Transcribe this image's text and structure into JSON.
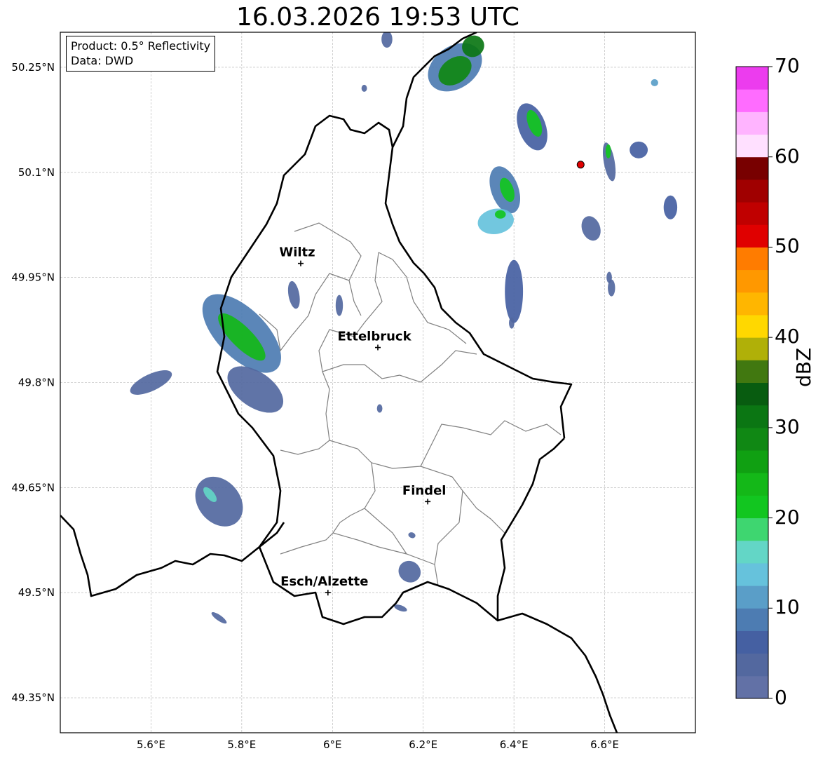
{
  "title": "16.03.2026 19:53 UTC",
  "info": {
    "product": "Product: 0.5° Reflectivity",
    "source": "Data: DWD"
  },
  "axes": {
    "lon_ticks": [
      {
        "value": 5.6,
        "label": "5.6°E"
      },
      {
        "value": 5.8,
        "label": "5.8°E"
      },
      {
        "value": 6.0,
        "label": "6°E"
      },
      {
        "value": 6.2,
        "label": "6.2°E"
      },
      {
        "value": 6.4,
        "label": "6.4°E"
      },
      {
        "value": 6.6,
        "label": "6.6°E"
      }
    ],
    "lat_ticks": [
      {
        "value": 50.25,
        "label": "50.25°N"
      },
      {
        "value": 50.1,
        "label": "50.1°N"
      },
      {
        "value": 49.95,
        "label": "49.95°N"
      },
      {
        "value": 49.8,
        "label": "49.8°N"
      },
      {
        "value": 49.65,
        "label": "49.65°N"
      },
      {
        "value": 49.5,
        "label": "49.5°N"
      },
      {
        "value": 49.35,
        "label": "49.35°N"
      }
    ],
    "lon_range": [
      5.4,
      6.8
    ],
    "lat_range": [
      49.3,
      50.3
    ],
    "grid": true
  },
  "places": [
    {
      "name": "Wiltz",
      "lon": 5.93,
      "lat": 49.97
    },
    {
      "name": "Ettelbruck",
      "lon": 6.1,
      "lat": 49.85
    },
    {
      "name": "Findel",
      "lon": 6.21,
      "lat": 49.63
    },
    {
      "name": "Esch/Alzette",
      "lon": 5.99,
      "lat": 49.5
    }
  ],
  "radar_site": {
    "lon": 6.547,
    "lat": 50.111,
    "color": "#e00000"
  },
  "colorbar": {
    "unit": "dBZ",
    "min": 0,
    "max": 70,
    "step": 2.5,
    "ticks": [
      {
        "value": 0,
        "label": "0"
      },
      {
        "value": 10,
        "label": "10"
      },
      {
        "value": 20,
        "label": "20"
      },
      {
        "value": 30,
        "label": "30"
      },
      {
        "value": 40,
        "label": "40"
      },
      {
        "value": 50,
        "label": "50"
      },
      {
        "value": 60,
        "label": "60"
      },
      {
        "value": 70,
        "label": "70"
      }
    ],
    "colors": [
      "#6271a6",
      "#53689f",
      "#4560a2",
      "#4d7cb2",
      "#5a9ec8",
      "#66c2dc",
      "#63d6c6",
      "#3ed670",
      "#12c620",
      "#14b818",
      "#10a012",
      "#108814",
      "#0b7613",
      "#085c10",
      "#417810",
      "#b0b008",
      "#ffd800",
      "#ffb600",
      "#ff9800",
      "#ff7c00",
      "#e00000",
      "#c00000",
      "#a00000",
      "#780000",
      "#ffe0ff",
      "#ffb4ff",
      "#ff6cff",
      "#ec3cee"
    ]
  },
  "echoes": [
    {
      "lon": 6.27,
      "lat": 50.25,
      "rx": 0.065,
      "ry": 0.03,
      "rot": -35,
      "dbz": 8
    },
    {
      "lon": 6.27,
      "lat": 50.245,
      "rx": 0.04,
      "ry": 0.018,
      "rot": -35,
      "dbz": 28
    },
    {
      "lon": 6.31,
      "lat": 50.28,
      "rx": 0.025,
      "ry": 0.015,
      "rot": -35,
      "dbz": 30
    },
    {
      "lon": 6.12,
      "lat": 50.29,
      "rx": 0.012,
      "ry": 0.012,
      "rot": 0,
      "dbz": 4
    },
    {
      "lon": 6.44,
      "lat": 50.165,
      "rx": 0.03,
      "ry": 0.035,
      "rot": -20,
      "dbz": 6
    },
    {
      "lon": 6.445,
      "lat": 50.17,
      "rx": 0.014,
      "ry": 0.02,
      "rot": -20,
      "dbz": 22
    },
    {
      "lon": 6.61,
      "lat": 50.115,
      "rx": 0.012,
      "ry": 0.028,
      "rot": -10,
      "dbz": 4
    },
    {
      "lon": 6.608,
      "lat": 50.13,
      "rx": 0.006,
      "ry": 0.01,
      "rot": 0,
      "dbz": 20
    },
    {
      "lon": 6.675,
      "lat": 50.132,
      "rx": 0.02,
      "ry": 0.012,
      "rot": 0,
      "dbz": 6
    },
    {
      "lon": 6.71,
      "lat": 50.228,
      "rx": 0.008,
      "ry": 0.005,
      "rot": 0,
      "dbz": 12
    },
    {
      "lon": 6.38,
      "lat": 50.075,
      "rx": 0.03,
      "ry": 0.035,
      "rot": -20,
      "dbz": 8
    },
    {
      "lon": 6.385,
      "lat": 50.075,
      "rx": 0.014,
      "ry": 0.018,
      "rot": -20,
      "dbz": 22
    },
    {
      "lon": 6.36,
      "lat": 50.03,
      "rx": 0.04,
      "ry": 0.018,
      "rot": -10,
      "dbz": 14
    },
    {
      "lon": 6.37,
      "lat": 50.04,
      "rx": 0.012,
      "ry": 0.006,
      "rot": 0,
      "dbz": 22
    },
    {
      "lon": 6.745,
      "lat": 50.05,
      "rx": 0.015,
      "ry": 0.017,
      "rot": 0,
      "dbz": 5
    },
    {
      "lon": 6.57,
      "lat": 50.02,
      "rx": 0.02,
      "ry": 0.018,
      "rot": -20,
      "dbz": 4
    },
    {
      "lon": 6.615,
      "lat": 49.935,
      "rx": 0.008,
      "ry": 0.012,
      "rot": 0,
      "dbz": 4
    },
    {
      "lon": 6.4,
      "lat": 49.93,
      "rx": 0.02,
      "ry": 0.045,
      "rot": 0,
      "dbz": 5
    },
    {
      "lon": 6.395,
      "lat": 49.885,
      "rx": 0.006,
      "ry": 0.008,
      "rot": 0,
      "dbz": 4
    },
    {
      "lon": 5.8,
      "lat": 49.87,
      "rx": 0.11,
      "ry": 0.035,
      "rot": 45,
      "dbz": 8
    },
    {
      "lon": 5.8,
      "lat": 49.865,
      "rx": 0.07,
      "ry": 0.015,
      "rot": 45,
      "dbz": 24
    },
    {
      "lon": 5.83,
      "lat": 49.79,
      "rx": 0.07,
      "ry": 0.025,
      "rot": 35,
      "dbz": 4
    },
    {
      "lon": 5.6,
      "lat": 49.8,
      "rx": 0.05,
      "ry": 0.012,
      "rot": -25,
      "dbz": 4
    },
    {
      "lon": 5.75,
      "lat": 49.63,
      "rx": 0.06,
      "ry": 0.03,
      "rot": 50,
      "dbz": 4
    },
    {
      "lon": 5.73,
      "lat": 49.64,
      "rx": 0.02,
      "ry": 0.006,
      "rot": 50,
      "dbz": 16
    },
    {
      "lon": 5.915,
      "lat": 49.925,
      "rx": 0.012,
      "ry": 0.02,
      "rot": -10,
      "dbz": 4
    },
    {
      "lon": 6.015,
      "lat": 49.91,
      "rx": 0.008,
      "ry": 0.015,
      "rot": 0,
      "dbz": 4
    },
    {
      "lon": 6.104,
      "lat": 49.763,
      "rx": 0.006,
      "ry": 0.006,
      "rot": 0,
      "dbz": 4
    },
    {
      "lon": 6.17,
      "lat": 49.53,
      "rx": 0.025,
      "ry": 0.015,
      "rot": 35,
      "dbz": 4
    },
    {
      "lon": 6.15,
      "lat": 49.478,
      "rx": 0.015,
      "ry": 0.004,
      "rot": 20,
      "dbz": 4
    },
    {
      "lon": 6.175,
      "lat": 49.582,
      "rx": 0.008,
      "ry": 0.004,
      "rot": 20,
      "dbz": 4
    },
    {
      "lon": 5.75,
      "lat": 49.464,
      "rx": 0.02,
      "ry": 0.004,
      "rot": 35,
      "dbz": 4
    },
    {
      "lon": 6.07,
      "lat": 50.22,
      "rx": 0.006,
      "ry": 0.005,
      "rot": 0,
      "dbz": 4
    },
    {
      "lon": 6.61,
      "lat": 49.95,
      "rx": 0.006,
      "ry": 0.008,
      "rot": 0,
      "dbz": 4
    }
  ]
}
